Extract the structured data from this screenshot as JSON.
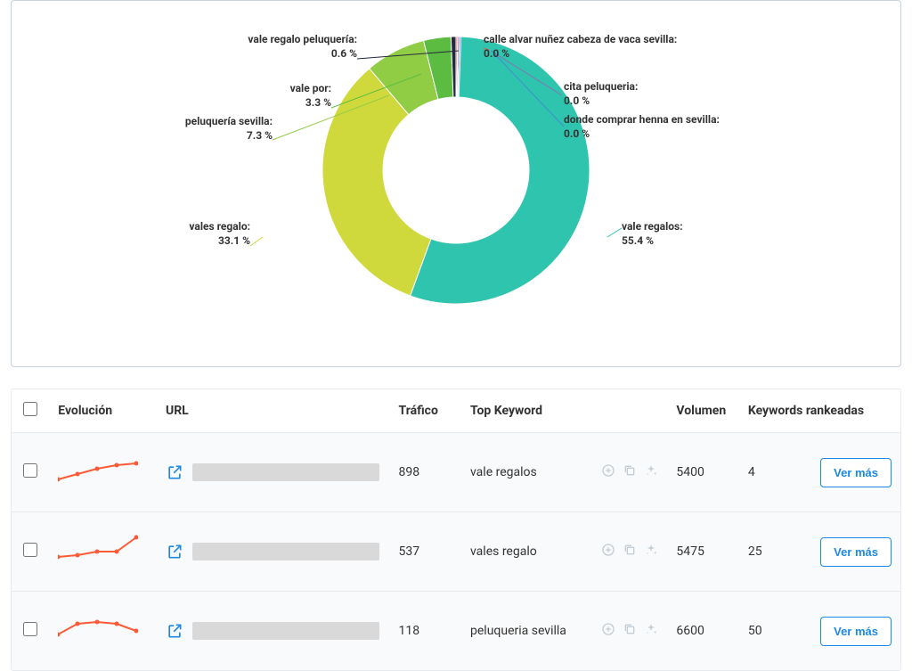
{
  "chart_data": {
    "type": "pie",
    "title": "",
    "segments": [
      {
        "label": "vale regalos",
        "value": 55.4,
        "color": "#2fc4ad",
        "display": "55.4 %"
      },
      {
        "label": "vales regalo",
        "value": 33.1,
        "color": "#d0d93b",
        "display": "33.1 %"
      },
      {
        "label": "peluquería sevilla",
        "value": 7.3,
        "color": "#91cc45",
        "display": "7.3 %"
      },
      {
        "label": "vale por",
        "value": 3.3,
        "color": "#5bbc41",
        "display": "3.3 %"
      },
      {
        "label": "vale regalo peluquería",
        "value": 0.6,
        "color": "#24293d",
        "display": "0.6 %"
      },
      {
        "label": "calle alvar nuñez cabeza de vaca sevilla",
        "value": 0.0,
        "color": "#e25b4b",
        "display": "0.0 %"
      },
      {
        "label": "cita peluqueria",
        "value": 0.0,
        "color": "#8a6fb3",
        "display": "0.0 %"
      },
      {
        "label": "donde comprar henna en sevilla",
        "value": 0.0,
        "color": "#3f8fd1",
        "display": "0.0 %"
      }
    ]
  },
  "labels": {
    "vale_regalos": {
      "name": "vale regalos:",
      "pct": "55.4 %"
    },
    "vales_regalo": {
      "name": "vales regalo:",
      "pct": "33.1 %"
    },
    "peluqueria_sevilla": {
      "name": "peluquería sevilla:",
      "pct": "7.3 %"
    },
    "vale_por": {
      "name": "vale por:",
      "pct": "3.3 %"
    },
    "vale_regalo_peluqueria": {
      "name": "vale regalo peluquería:",
      "pct": "0.6 %"
    },
    "calle_alvar": {
      "name": "calle alvar nuñez cabeza de vaca sevilla:",
      "pct": "0.0 %"
    },
    "cita_peluqueria": {
      "name": "cita peluqueria:",
      "pct": "0.0 %"
    },
    "donde_henna": {
      "name": "donde comprar henna en sevilla:",
      "pct": "0.0 %"
    }
  },
  "table": {
    "headers": {
      "evolucion": "Evolución",
      "url": "URL",
      "trafico": "Tráfico",
      "top_keyword": "Top Keyword",
      "volumen": "Volumen",
      "keywords_rankeadas": "Keywords rankeadas"
    },
    "more_button": "Ver más",
    "rows": [
      {
        "trafico": "898",
        "top_keyword": "vale regalos",
        "volumen": "5400",
        "rankeadas": "4"
      },
      {
        "trafico": "537",
        "top_keyword": "vales regalo",
        "volumen": "5475",
        "rankeadas": "25"
      },
      {
        "trafico": "118",
        "top_keyword": "peluqueria sevilla",
        "volumen": "6600",
        "rankeadas": "50"
      }
    ]
  }
}
